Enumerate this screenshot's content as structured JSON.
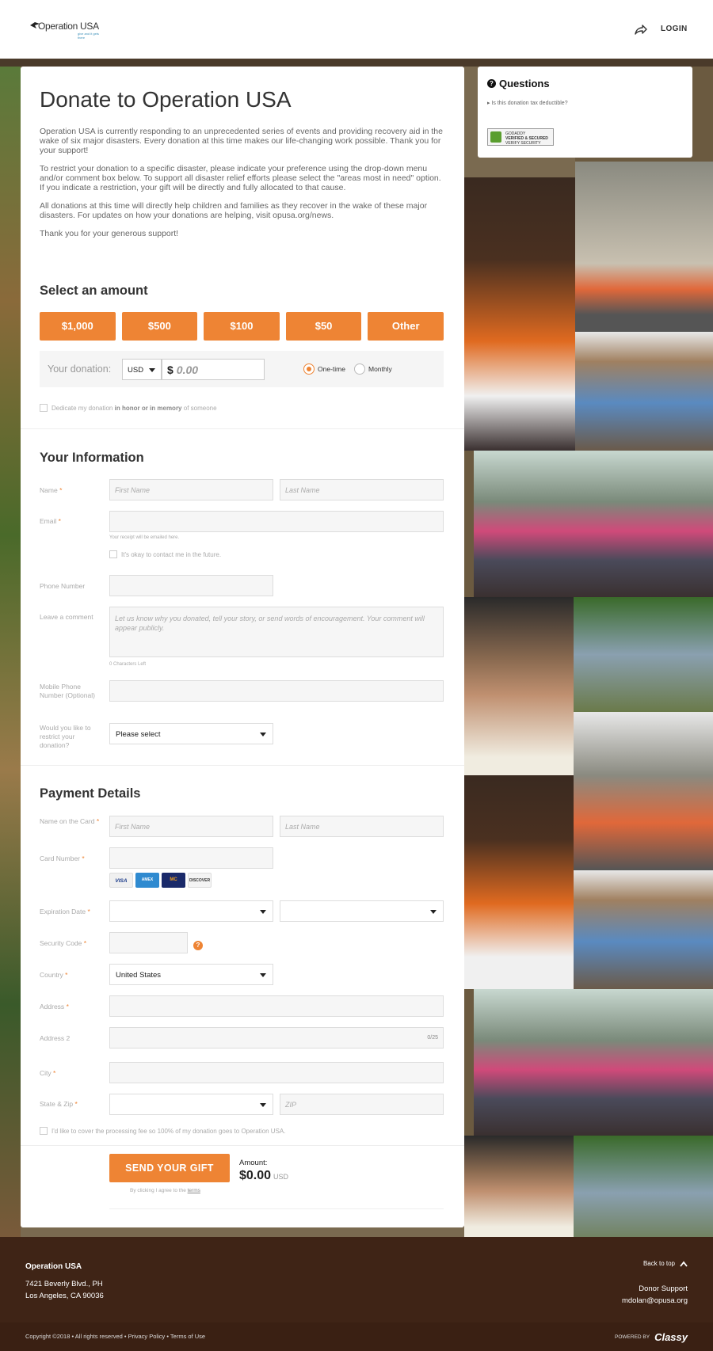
{
  "header": {
    "logo_text": "Operation USA",
    "logo_tagline": "give and it gets there",
    "login_label": "LOGIN"
  },
  "colors": {
    "accent": "#ee8434",
    "footer": "#3f2416"
  },
  "form": {
    "title": "Donate to Operation USA",
    "intro": [
      "Operation USA is currently responding to an unprecedented series of events and providing recovery aid in the wake of six major disasters. Every donation at this time makes our life-changing work possible. Thank you for your support!",
      "To restrict your donation to a specific disaster, please indicate your preference using the drop-down menu and/or comment box below. To support all disaster relief efforts please select the \"areas most in need\" option. If you indicate a restriction, your gift will be directly and fully allocated to that cause.",
      "All donations at this time will directly help children and families as they recover in the wake of these major disasters. For updates on how your donations are helping, visit opusa.org/news.",
      "Thank you for your generous support!"
    ],
    "amount_heading": "Select an amount",
    "amounts": [
      "$1,000",
      "$500",
      "$100",
      "$50",
      "Other"
    ],
    "your_donation_label": "Your donation:",
    "currency": "USD",
    "dollar_sign": "$",
    "amount_placeholder": "0.00",
    "frequency": {
      "one_time": "One-time",
      "monthly": "Monthly",
      "selected": "One-time"
    },
    "dedicate": {
      "pre": "Dedicate my donation ",
      "bold": "in honor or in memory",
      "post": " of someone"
    },
    "info_heading": "Your Information",
    "name_label": "Name",
    "first_name_placeholder": "First Name",
    "last_name_placeholder": "Last Name",
    "email_label": "Email",
    "email_hint": "Your receipt will be emailed here.",
    "contact_ok": "It's okay to contact me in the future.",
    "phone_label": "Phone Number",
    "comment_label": "Leave a comment",
    "comment_placeholder": "Let us know why you donated, tell your story, or send words of encouragement. Your comment will appear publicly.",
    "chars_left": "0 Characters Left",
    "mobile_label": "Mobile Phone Number (Optional)",
    "restrict_label": "Would you like to restrict your donation?",
    "restrict_value": "Please select",
    "payment_heading": "Payment Details",
    "card_name_label": "Name on the Card",
    "card_number_label": "Card Number",
    "card_brands": [
      "VISA",
      "AMEX",
      "MC",
      "DISCOVER"
    ],
    "expiration_label": "Expiration Date",
    "security_label": "Security Code",
    "help_glyph": "?",
    "country_label": "Country",
    "country_value": "United States",
    "address_label": "Address",
    "address2_label": "Address 2",
    "address2_counter": "0/25",
    "city_label": "City",
    "state_zip_label": "State & Zip",
    "zip_placeholder": "ZIP",
    "cover_fee": "I'd like to cover the processing fee so 100% of my donation goes to Operation USA.",
    "send_label": "SEND YOUR GIFT",
    "terms_pre": "By clicking I agree to the ",
    "terms_link": "terms",
    "amount_label": "Amount:",
    "amount_total": "$0.00",
    "amount_currency": "USD"
  },
  "questions": {
    "title": "Questions",
    "link": "Is this donation tax deductible?",
    "badge_line1": "GODADDY",
    "badge_line2": "VERIFIED & SECURED",
    "badge_line3": "VERIFY SECURITY"
  },
  "footer": {
    "org": "Operation USA",
    "address1": "7421 Beverly Blvd., PH",
    "address2": "Los Angeles, CA 90036",
    "back_to_top": "Back to top",
    "support_title": "Donor Support",
    "support_email": "mdolan@opusa.org",
    "copyright": "Copyright ©2018 • All rights reserved • Privacy Policy • Terms of Use",
    "powered_by": "POWERED BY",
    "brand": "Classy"
  }
}
